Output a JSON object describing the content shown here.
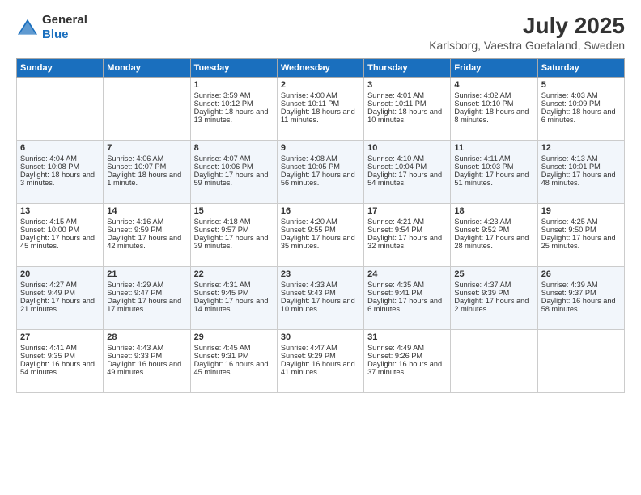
{
  "logo": {
    "general": "General",
    "blue": "Blue"
  },
  "title": "July 2025",
  "subtitle": "Karlsborg, Vaestra Goetaland, Sweden",
  "headers": [
    "Sunday",
    "Monday",
    "Tuesday",
    "Wednesday",
    "Thursday",
    "Friday",
    "Saturday"
  ],
  "weeks": [
    [
      {
        "day": "",
        "info": ""
      },
      {
        "day": "",
        "info": ""
      },
      {
        "day": "1",
        "info": "Sunrise: 3:59 AM\nSunset: 10:12 PM\nDaylight: 18 hours and 13 minutes."
      },
      {
        "day": "2",
        "info": "Sunrise: 4:00 AM\nSunset: 10:11 PM\nDaylight: 18 hours and 11 minutes."
      },
      {
        "day": "3",
        "info": "Sunrise: 4:01 AM\nSunset: 10:11 PM\nDaylight: 18 hours and 10 minutes."
      },
      {
        "day": "4",
        "info": "Sunrise: 4:02 AM\nSunset: 10:10 PM\nDaylight: 18 hours and 8 minutes."
      },
      {
        "day": "5",
        "info": "Sunrise: 4:03 AM\nSunset: 10:09 PM\nDaylight: 18 hours and 6 minutes."
      }
    ],
    [
      {
        "day": "6",
        "info": "Sunrise: 4:04 AM\nSunset: 10:08 PM\nDaylight: 18 hours and 3 minutes."
      },
      {
        "day": "7",
        "info": "Sunrise: 4:06 AM\nSunset: 10:07 PM\nDaylight: 18 hours and 1 minute."
      },
      {
        "day": "8",
        "info": "Sunrise: 4:07 AM\nSunset: 10:06 PM\nDaylight: 17 hours and 59 minutes."
      },
      {
        "day": "9",
        "info": "Sunrise: 4:08 AM\nSunset: 10:05 PM\nDaylight: 17 hours and 56 minutes."
      },
      {
        "day": "10",
        "info": "Sunrise: 4:10 AM\nSunset: 10:04 PM\nDaylight: 17 hours and 54 minutes."
      },
      {
        "day": "11",
        "info": "Sunrise: 4:11 AM\nSunset: 10:03 PM\nDaylight: 17 hours and 51 minutes."
      },
      {
        "day": "12",
        "info": "Sunrise: 4:13 AM\nSunset: 10:01 PM\nDaylight: 17 hours and 48 minutes."
      }
    ],
    [
      {
        "day": "13",
        "info": "Sunrise: 4:15 AM\nSunset: 10:00 PM\nDaylight: 17 hours and 45 minutes."
      },
      {
        "day": "14",
        "info": "Sunrise: 4:16 AM\nSunset: 9:59 PM\nDaylight: 17 hours and 42 minutes."
      },
      {
        "day": "15",
        "info": "Sunrise: 4:18 AM\nSunset: 9:57 PM\nDaylight: 17 hours and 39 minutes."
      },
      {
        "day": "16",
        "info": "Sunrise: 4:20 AM\nSunset: 9:55 PM\nDaylight: 17 hours and 35 minutes."
      },
      {
        "day": "17",
        "info": "Sunrise: 4:21 AM\nSunset: 9:54 PM\nDaylight: 17 hours and 32 minutes."
      },
      {
        "day": "18",
        "info": "Sunrise: 4:23 AM\nSunset: 9:52 PM\nDaylight: 17 hours and 28 minutes."
      },
      {
        "day": "19",
        "info": "Sunrise: 4:25 AM\nSunset: 9:50 PM\nDaylight: 17 hours and 25 minutes."
      }
    ],
    [
      {
        "day": "20",
        "info": "Sunrise: 4:27 AM\nSunset: 9:49 PM\nDaylight: 17 hours and 21 minutes."
      },
      {
        "day": "21",
        "info": "Sunrise: 4:29 AM\nSunset: 9:47 PM\nDaylight: 17 hours and 17 minutes."
      },
      {
        "day": "22",
        "info": "Sunrise: 4:31 AM\nSunset: 9:45 PM\nDaylight: 17 hours and 14 minutes."
      },
      {
        "day": "23",
        "info": "Sunrise: 4:33 AM\nSunset: 9:43 PM\nDaylight: 17 hours and 10 minutes."
      },
      {
        "day": "24",
        "info": "Sunrise: 4:35 AM\nSunset: 9:41 PM\nDaylight: 17 hours and 6 minutes."
      },
      {
        "day": "25",
        "info": "Sunrise: 4:37 AM\nSunset: 9:39 PM\nDaylight: 17 hours and 2 minutes."
      },
      {
        "day": "26",
        "info": "Sunrise: 4:39 AM\nSunset: 9:37 PM\nDaylight: 16 hours and 58 minutes."
      }
    ],
    [
      {
        "day": "27",
        "info": "Sunrise: 4:41 AM\nSunset: 9:35 PM\nDaylight: 16 hours and 54 minutes."
      },
      {
        "day": "28",
        "info": "Sunrise: 4:43 AM\nSunset: 9:33 PM\nDaylight: 16 hours and 49 minutes."
      },
      {
        "day": "29",
        "info": "Sunrise: 4:45 AM\nSunset: 9:31 PM\nDaylight: 16 hours and 45 minutes."
      },
      {
        "day": "30",
        "info": "Sunrise: 4:47 AM\nSunset: 9:29 PM\nDaylight: 16 hours and 41 minutes."
      },
      {
        "day": "31",
        "info": "Sunrise: 4:49 AM\nSunset: 9:26 PM\nDaylight: 16 hours and 37 minutes."
      },
      {
        "day": "",
        "info": ""
      },
      {
        "day": "",
        "info": ""
      }
    ]
  ]
}
